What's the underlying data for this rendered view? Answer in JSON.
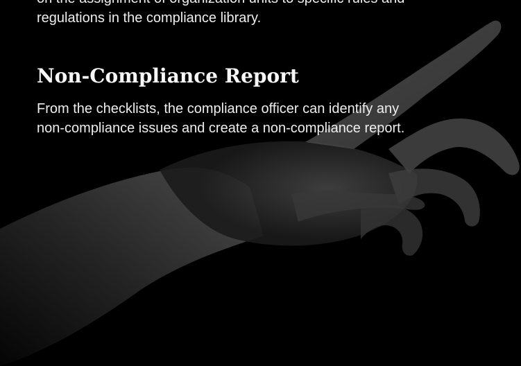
{
  "intro": {
    "line1": "on the assignment of organization units to specific rules and",
    "line2": "regulations in the compliance library."
  },
  "section": {
    "title": "Non-Compliance Report",
    "body_line1": "From the checklists, the compliance officer can identify any",
    "body_line2": "non-compliance issues and create a non-compliance report."
  },
  "colors": {
    "background": "#000000",
    "text": "#eeeeee",
    "heading": "#f7f7f7"
  },
  "icons": {
    "background_image": "pointing-hand-image"
  }
}
